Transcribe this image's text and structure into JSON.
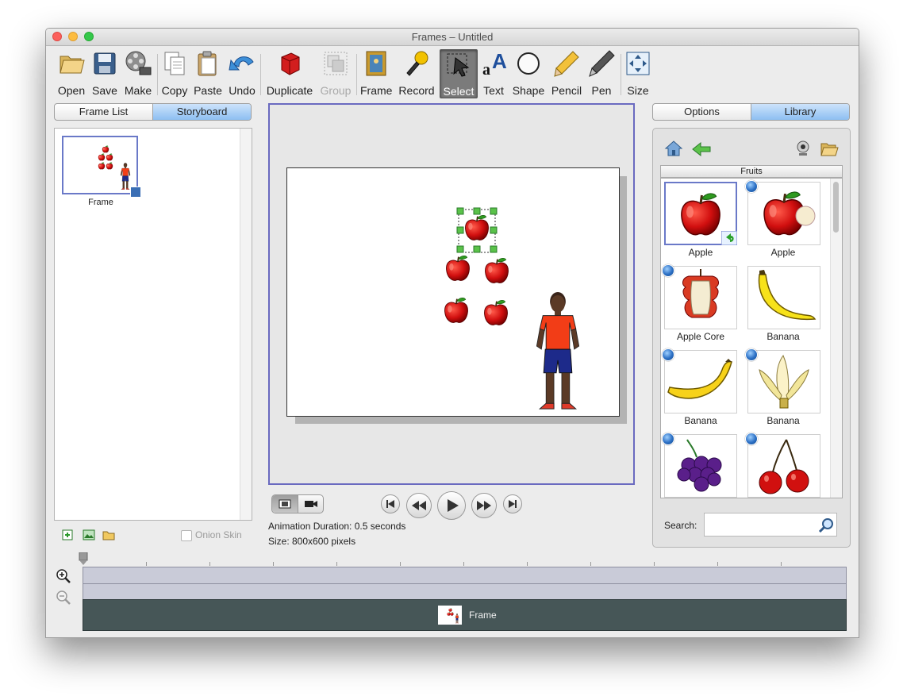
{
  "window": {
    "title": "Frames – Untitled"
  },
  "toolbar": {
    "open": "Open",
    "save": "Save",
    "make": "Make",
    "copy": "Copy",
    "paste": "Paste",
    "undo": "Undo",
    "duplicate": "Duplicate",
    "group": "Group",
    "frame": "Frame",
    "record": "Record",
    "select": "Select",
    "text": "Text",
    "shape": "Shape",
    "pencil": "Pencil",
    "pen": "Pen",
    "size": "Size"
  },
  "left_tabs": {
    "frame_list": "Frame List",
    "storyboard": "Storyboard"
  },
  "storyboard": {
    "frame_label": "Frame"
  },
  "left_footer": {
    "onion_skin": "Onion Skin"
  },
  "right_tabs": {
    "options": "Options",
    "library": "Library"
  },
  "library": {
    "category": "Fruits",
    "items": [
      "Apple",
      "Apple",
      "Apple Core",
      "Banana",
      "Banana",
      "Banana"
    ],
    "search_label": "Search:",
    "search_value": ""
  },
  "info": {
    "duration": "Animation Duration: 0.5 seconds",
    "size": "Size: 800x600 pixels"
  },
  "timeline": {
    "frame_label": "Frame"
  },
  "colors": {
    "accent": "#6a79c8",
    "tab_selected": "#8dbff2",
    "timeline_bar": "#465657"
  }
}
